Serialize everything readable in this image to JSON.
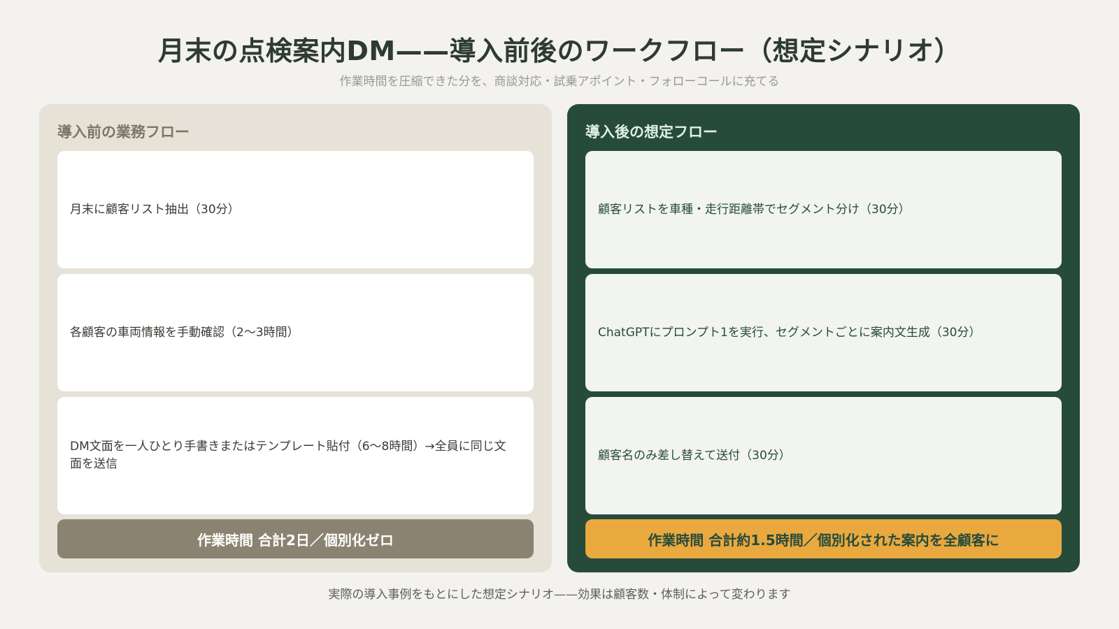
{
  "header": {
    "title": "月末の点検案内DM——導入前後のワークフロー（想定シナリオ）",
    "subtitle": "作業時間を圧縮できた分を、商談対応・試乗アポイント・フォローコールに充てる"
  },
  "before": {
    "title": "導入前の業務フロー",
    "steps": [
      "月末に顧客リスト抽出（30分）",
      "各顧客の車両情報を手動確認（2〜3時間）",
      "DM文面を一人ひとり手書きまたはテンプレート貼付（6〜8時間）→全員に同じ文面を送信"
    ],
    "summary": "作業時間 合計2日／個別化ゼロ"
  },
  "after": {
    "title": "導入後の想定フロー",
    "steps": [
      "顧客リストを車種・走行距離帯でセグメント分け（30分）",
      "ChatGPTにプロンプト1を実行、セグメントごとに案内文生成（30分）",
      "顧客名のみ差し替えて送付（30分）"
    ],
    "summary": "作業時間 合計約1.5時間／個別化された案内を全顧客に"
  },
  "footer": {
    "note": "実際の導入事例をもとにした想定シナリオ——効果は顧客数・体制によって変わります"
  },
  "colors": {
    "background": "#f3f2ee",
    "before_panel": "#e6e2d7",
    "after_panel": "#274b3b",
    "before_summary": "#8b8371",
    "after_summary": "#e9a93f"
  }
}
